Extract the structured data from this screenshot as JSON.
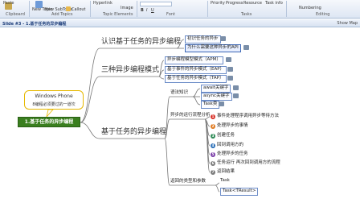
{
  "ribbon": {
    "paste": "Paste",
    "clipboard": "Clipboard",
    "new_topic": "New Topic",
    "new_subtopic": "New SubTopic",
    "callout": "Callout",
    "add_topics": "Add Topics",
    "hyperlink": "Hyperlink",
    "image": "Image",
    "topic_elements": "Topic Elements",
    "font": "Font",
    "priority": "Priority",
    "progress": "Progress",
    "resource": "Resource",
    "task_info": "Task info",
    "tasks": "Tasks",
    "numbering": "Numbering",
    "editing": "Editing"
  },
  "titlebar": {
    "title": "Slide #3 - 1.基于任务的异步编程",
    "show_map": "Show Map"
  },
  "map": {
    "central": "1.基于任务的异步编程",
    "callout_line1": "Windows Phone",
    "callout_line2": "8编程必须要过的一道坎",
    "b1": "认识基于任务的异步编程",
    "b1_c1": "初识任务的异步",
    "b1_c2": "为什么需要这种异步的API",
    "b2": "三种异步编程模式",
    "b2_c1": "异步编程模型模式（APM）",
    "b2_c2": "基于事件的异步模式（EAP）",
    "b2_c3": "基于任务的异步模式（TAP）",
    "b3": "基于任务的异步编程",
    "b3_k1": "语法知识",
    "b3_k1_c1": "await关键字",
    "b3_k1_c2": "async关键字",
    "b3_k1_c3": "Task类",
    "b3_k2": "异步的运行流程分析",
    "b3_k2_items": [
      "事件处理程序调用异步等待方法",
      "处理异步的事情",
      "创建任务",
      "回到调用方的",
      "处理异步的任务",
      "任务运行 再次回到调用方的流程",
      "返回结果"
    ],
    "b3_k3": "返回的类型和参数",
    "b3_k3_c1": "Task",
    "b3_k3_c2": "Task<TResult>"
  }
}
